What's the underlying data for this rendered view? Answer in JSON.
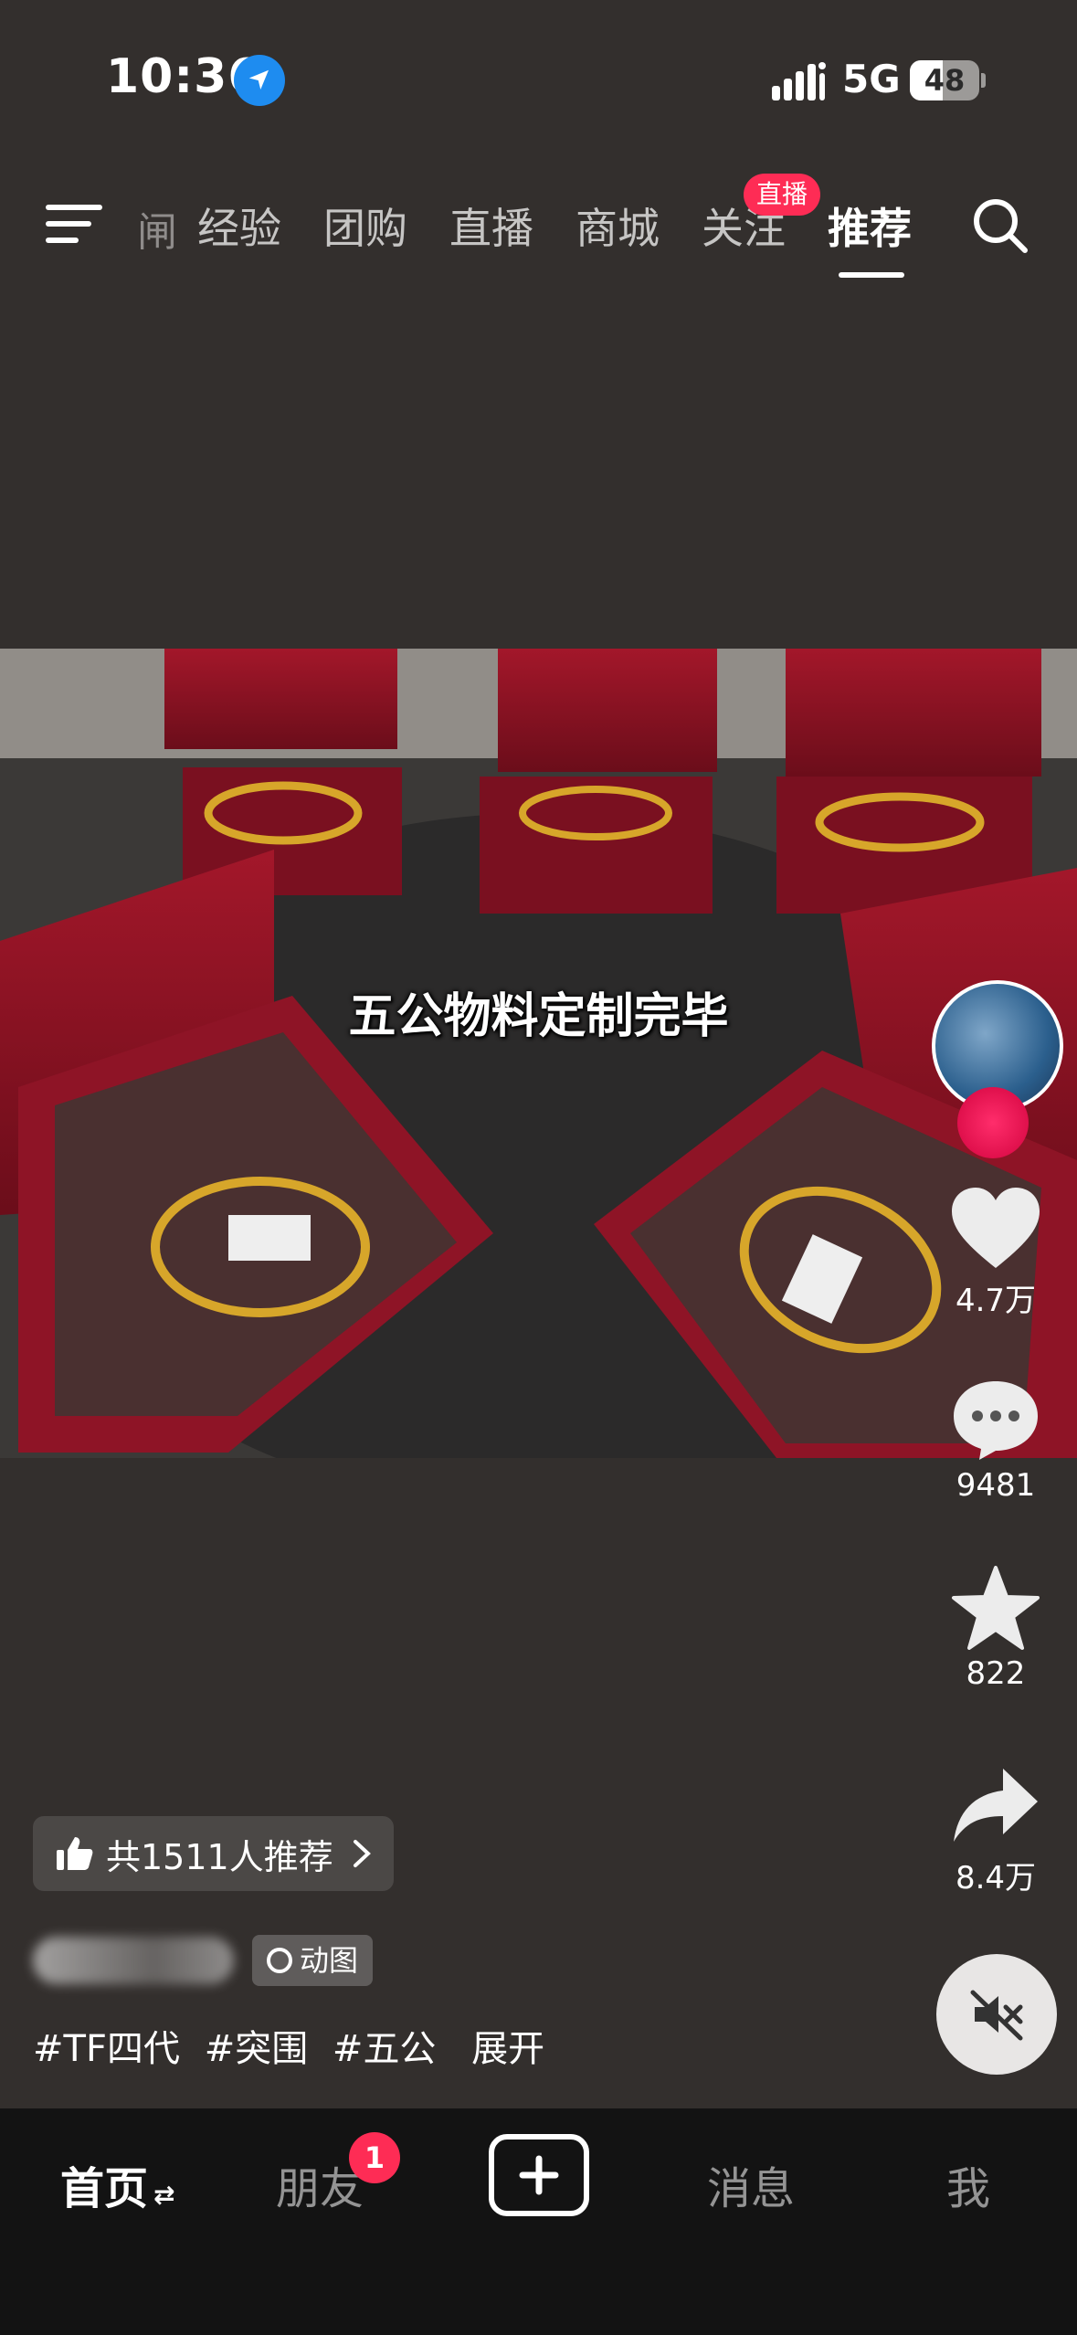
{
  "status_bar": {
    "time": "10:36",
    "network": "5G",
    "battery": "48"
  },
  "top_nav": {
    "cut_tab": "闸",
    "tabs": [
      "经验",
      "团购",
      "直播",
      "商城",
      "关注",
      "推荐"
    ],
    "active_tab": "推荐",
    "live_badge": "直播"
  },
  "video": {
    "caption": "五公物料定制完毕"
  },
  "right_rail": {
    "likes": "4.7万",
    "comments": "9481",
    "favorites": "822",
    "shares": "8.4万"
  },
  "info": {
    "recommend": "共1511人推荐",
    "chip_label": "动图",
    "hashtags": [
      "#TF四代",
      "#突围",
      "#五公"
    ],
    "expand": "展开"
  },
  "tab_bar": {
    "home": "首页",
    "friends": "朋友",
    "friends_badge": "1",
    "messages": "消息",
    "me": "我"
  },
  "colors": {
    "accent": "#fe2c55",
    "bg": "#332f2d",
    "tabbar": "#131313"
  }
}
